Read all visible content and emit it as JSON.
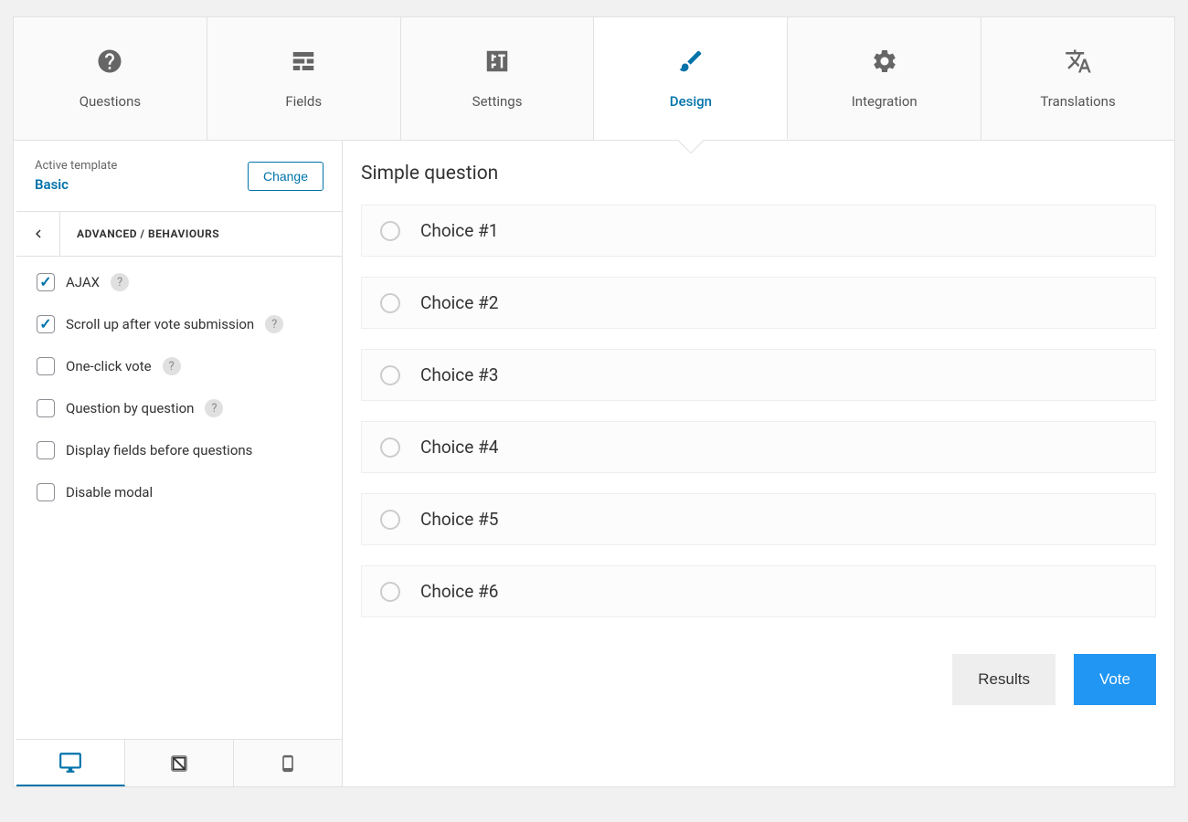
{
  "tabs": [
    {
      "label": "Questions"
    },
    {
      "label": "Fields"
    },
    {
      "label": "Settings"
    },
    {
      "label": "Design"
    },
    {
      "label": "Integration"
    },
    {
      "label": "Translations"
    }
  ],
  "sidebar": {
    "template_label": "Active template",
    "template_name": "Basic",
    "change_button": "Change",
    "section_title": "ADVANCED / BEHAVIOURS",
    "options": [
      {
        "label": "AJAX",
        "checked": true,
        "help": "?"
      },
      {
        "label": "Scroll up after vote submission",
        "checked": true,
        "help": "?"
      },
      {
        "label": "One-click vote",
        "checked": false,
        "help": "?"
      },
      {
        "label": "Question by question",
        "checked": false,
        "help": "?"
      },
      {
        "label": "Display fields before questions",
        "checked": false
      },
      {
        "label": "Disable modal",
        "checked": false
      }
    ]
  },
  "preview": {
    "question_title": "Simple question",
    "choices": [
      "Choice #1",
      "Choice #2",
      "Choice #3",
      "Choice #4",
      "Choice #5",
      "Choice #6"
    ],
    "results_button": "Results",
    "vote_button": "Vote"
  }
}
